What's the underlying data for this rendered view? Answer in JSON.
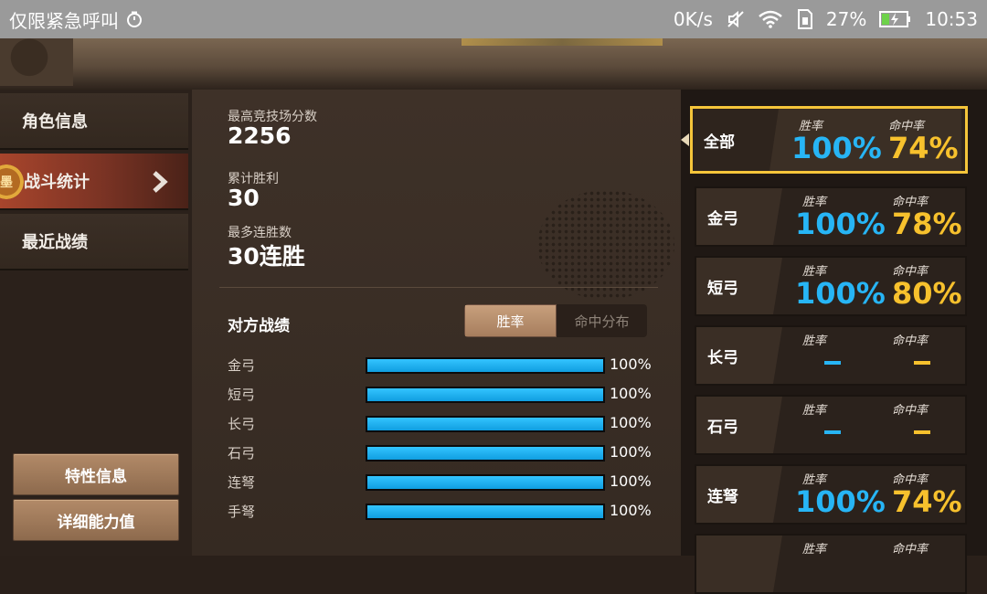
{
  "status_bar": {
    "carrier": "仅限紧急呼叫",
    "speed": "0K/s",
    "battery": "27%",
    "time": "10:53"
  },
  "menu": {
    "items": [
      {
        "label": "角色信息",
        "active": false
      },
      {
        "label": "战斗统计",
        "active": true
      },
      {
        "label": "最近战绩",
        "active": false
      }
    ],
    "badge_char": "墨",
    "buttons": [
      "特性信息",
      "详细能力值"
    ]
  },
  "stats": {
    "highest_arena_score_label": "最高竞技场分数",
    "highest_arena_score": "2256",
    "total_wins_label": "累计胜利",
    "total_wins": "30",
    "max_streak_label": "最多连胜数",
    "max_streak": "30连胜"
  },
  "opponent": {
    "title": "对方战绩",
    "tabs": [
      {
        "label": "胜率",
        "active": true
      },
      {
        "label": "命中分布",
        "active": false
      }
    ],
    "rows": [
      {
        "name": "金弓",
        "percent": 100,
        "label": "100%"
      },
      {
        "name": "短弓",
        "percent": 100,
        "label": "100%"
      },
      {
        "name": "长弓",
        "percent": 100,
        "label": "100%"
      },
      {
        "name": "石弓",
        "percent": 100,
        "label": "100%"
      },
      {
        "name": "连弩",
        "percent": 100,
        "label": "100%"
      },
      {
        "name": "手弩",
        "percent": 100,
        "label": "100%"
      }
    ]
  },
  "weapon_cards": {
    "win_label": "胜率",
    "hit_label": "命中率",
    "cards": [
      {
        "name": "全部",
        "win": "100%",
        "hit": "74%",
        "selected": true
      },
      {
        "name": "金弓",
        "win": "100%",
        "hit": "78%"
      },
      {
        "name": "短弓",
        "win": "100%",
        "hit": "80%"
      },
      {
        "name": "长弓",
        "win": "",
        "hit": ""
      },
      {
        "name": "石弓",
        "win": "",
        "hit": ""
      },
      {
        "name": "连弩",
        "win": "100%",
        "hit": "74%"
      },
      {
        "name": "",
        "win": "",
        "hit": ""
      }
    ]
  },
  "colors": {
    "win_blue": "#27b5f5",
    "hit_gold": "#f7c12d",
    "selected_border": "#f5c53a",
    "bar_fill": "#1aa8ea"
  }
}
